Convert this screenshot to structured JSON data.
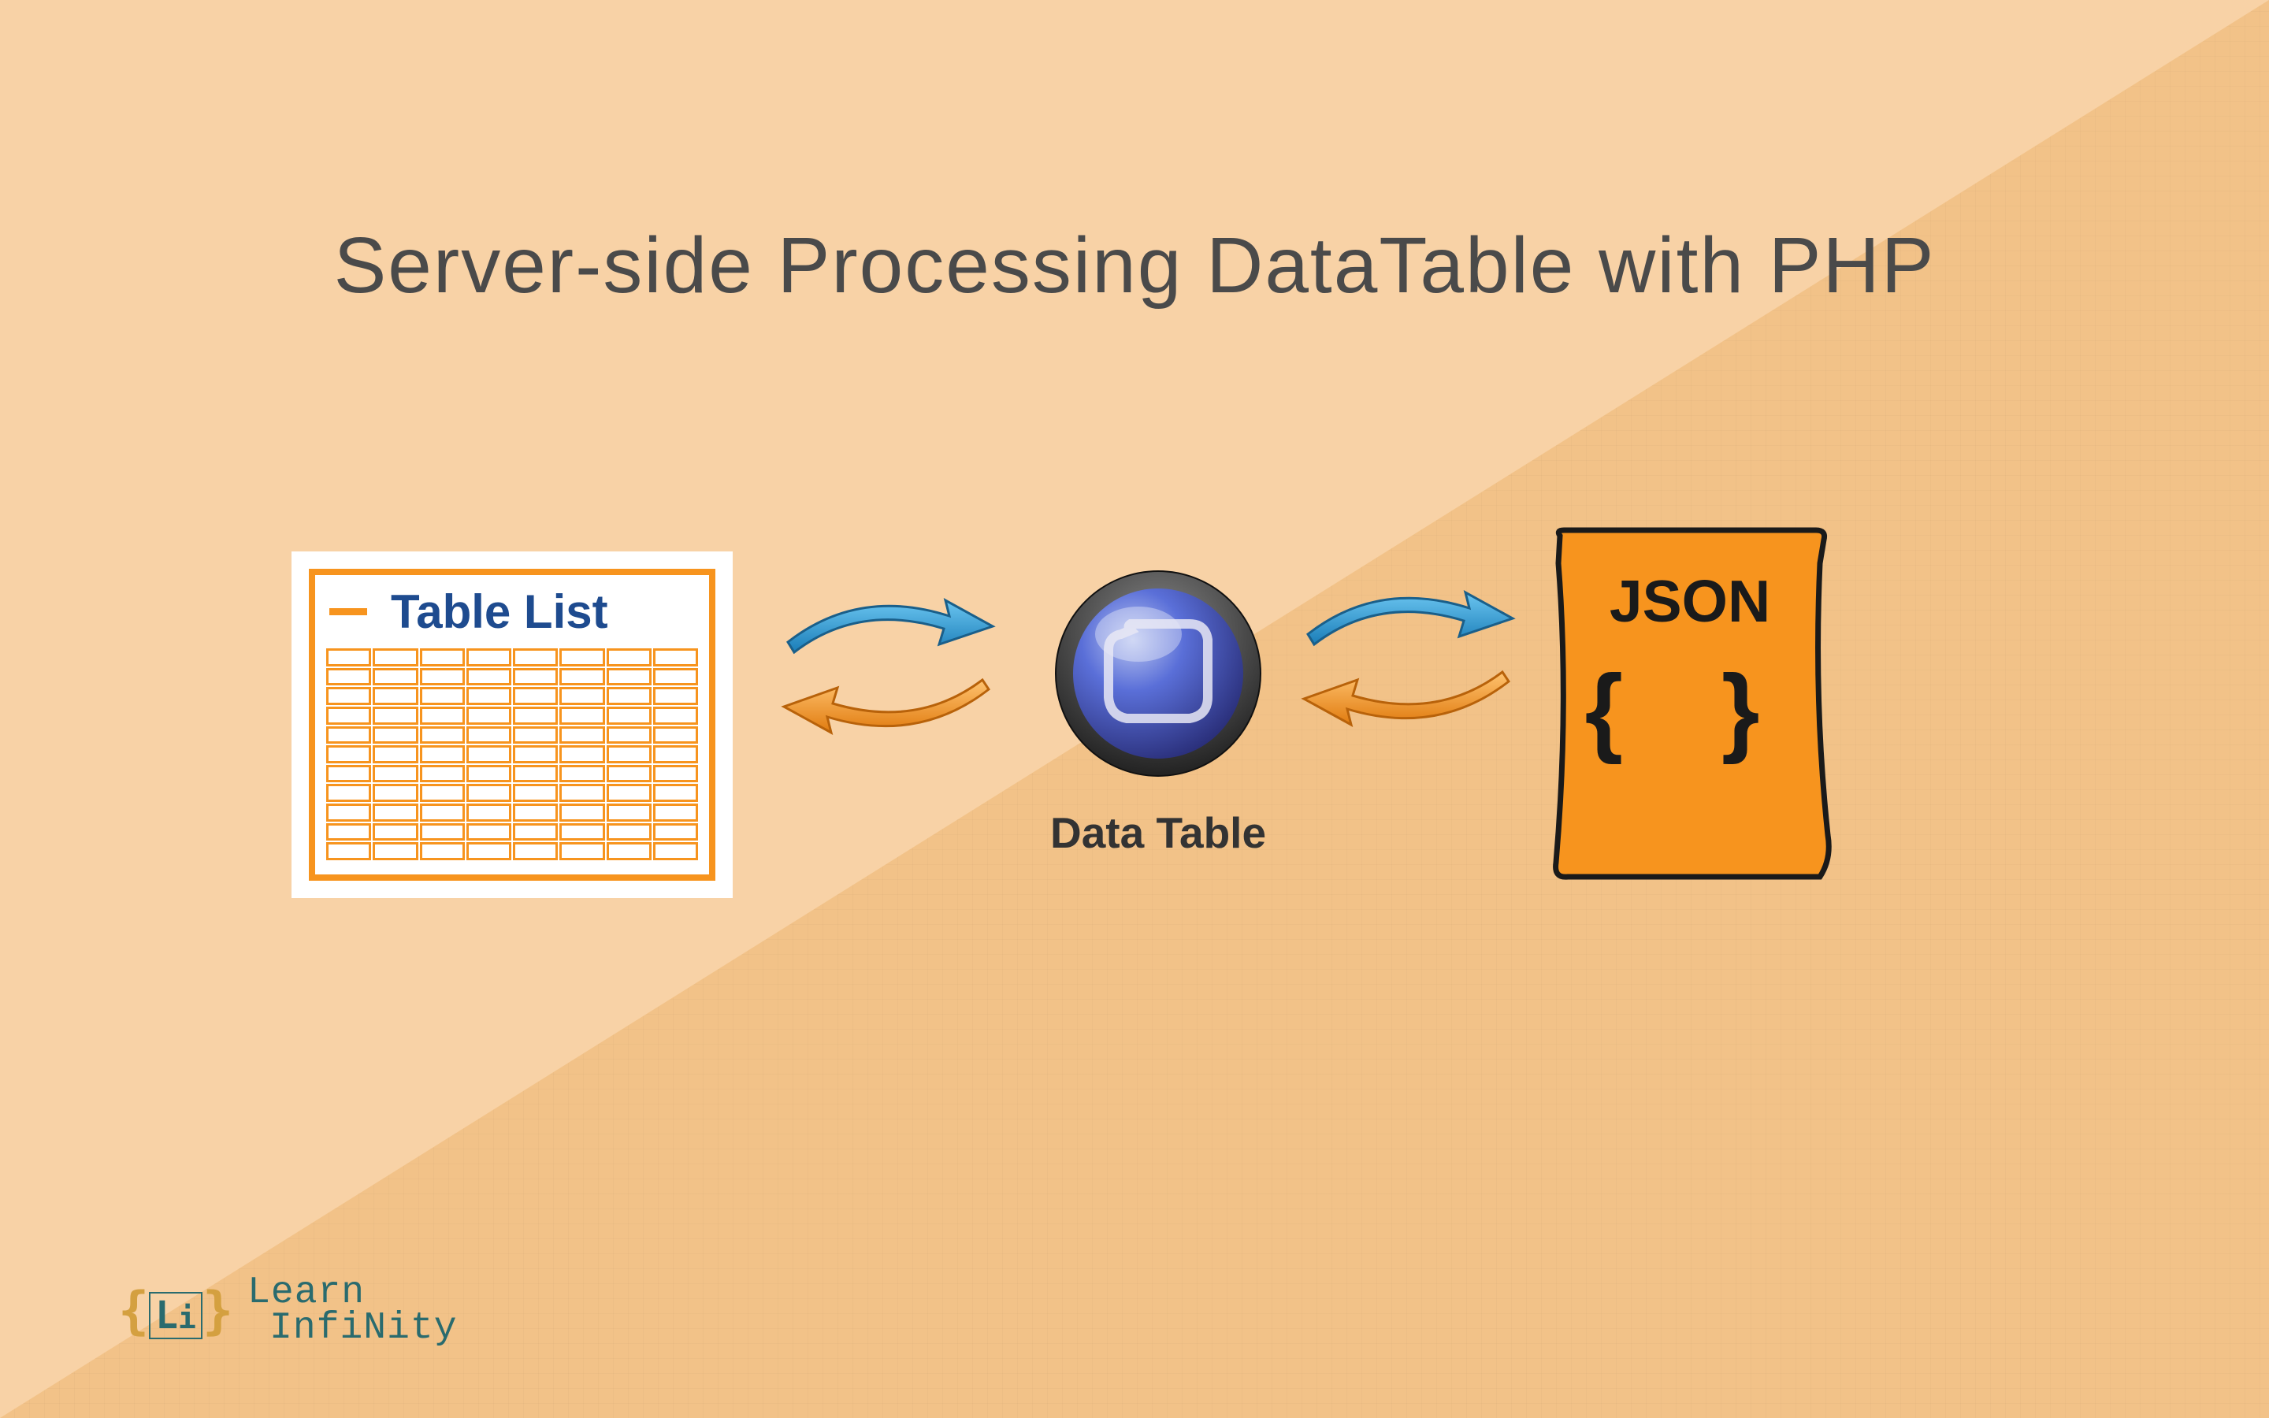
{
  "title": "Server-side Processing DataTable with PHP",
  "table": {
    "label": "Table List",
    "rows": 11,
    "cols": 8
  },
  "datatable": {
    "label": "Data Table"
  },
  "json": {
    "label": "JSON",
    "braces": "{ }"
  },
  "logo": {
    "icon": "{Li}",
    "text_top": "Learn",
    "text_bottom": "InfiNity"
  },
  "colors": {
    "bg_light": "#f8d2a6",
    "bg_dark": "#f2c288",
    "orange": "#f7941e",
    "blue_arrow": "#2b9cd8",
    "teal": "#2a6b6e",
    "navy": "#1e4b8f"
  }
}
